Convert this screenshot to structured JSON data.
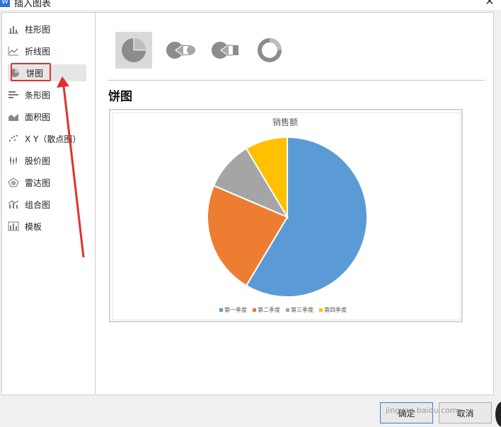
{
  "window": {
    "title": "插入图表",
    "close_glyph": "✕"
  },
  "sidebar": {
    "items": [
      {
        "label": "柱形图",
        "icon": "column-chart-icon"
      },
      {
        "label": "折线图",
        "icon": "line-chart-icon"
      },
      {
        "label": "饼图",
        "icon": "pie-chart-icon",
        "selected": true
      },
      {
        "label": "条形图",
        "icon": "bar-chart-icon"
      },
      {
        "label": "面积图",
        "icon": "area-chart-icon"
      },
      {
        "label": "X Y（散点图）",
        "icon": "scatter-chart-icon"
      },
      {
        "label": "股价图",
        "icon": "stock-chart-icon"
      },
      {
        "label": "雷达图",
        "icon": "radar-chart-icon"
      },
      {
        "label": "组合图",
        "icon": "combo-chart-icon"
      },
      {
        "label": "模板",
        "icon": "template-icon"
      }
    ]
  },
  "subtypes": [
    {
      "icon": "pie-icon",
      "selected": true
    },
    {
      "icon": "pie-of-pie-icon"
    },
    {
      "icon": "bar-of-pie-icon"
    },
    {
      "icon": "doughnut-icon"
    }
  ],
  "section_heading": "饼图",
  "chart_data": {
    "type": "pie",
    "title": "销售额",
    "categories": [
      "第一季度",
      "第二季度",
      "第三季度",
      "第四季度"
    ],
    "values": [
      8.2,
      3.2,
      1.4,
      1.2
    ],
    "colors": [
      "#5b9bd5",
      "#ed7d31",
      "#a5a5a5",
      "#ffc000"
    ],
    "legend_position": "bottom"
  },
  "buttons": {
    "ok": "确定",
    "cancel": "取消"
  },
  "watermark": "jingyan.baidu.com",
  "annotation": {
    "color": "#e0322c"
  }
}
